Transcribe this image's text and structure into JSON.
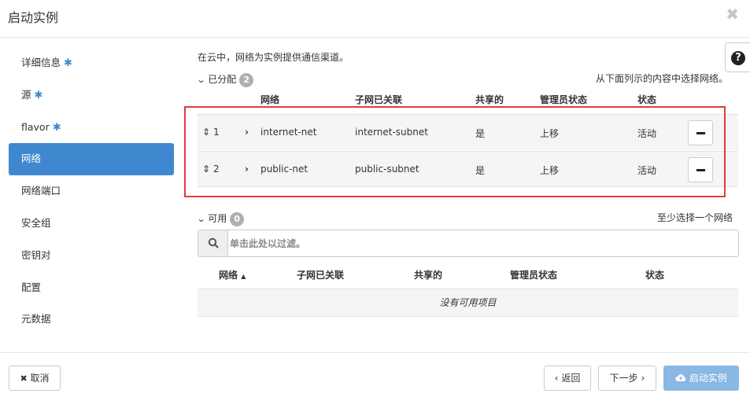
{
  "modal": {
    "title": "启动实例",
    "close": "✖"
  },
  "sidebar": {
    "items": [
      {
        "label": "详细信息",
        "required": true
      },
      {
        "label": "源",
        "required": true
      },
      {
        "label": "flavor",
        "required": true
      },
      {
        "label": "网络",
        "required": false,
        "active": true
      },
      {
        "label": "网络端口",
        "required": false
      },
      {
        "label": "安全组",
        "required": false
      },
      {
        "label": "密钥对",
        "required": false
      },
      {
        "label": "配置",
        "required": false
      },
      {
        "label": "元数据",
        "required": false
      }
    ],
    "required_mark": "✱"
  },
  "help": {
    "symbol": "?"
  },
  "description": "在云中，网络为实例提供通信渠道。",
  "allocated": {
    "title": "已分配",
    "count": "2",
    "hint": "从下面列示的内容中选择网络。",
    "columns": [
      "网络",
      "子网已关联",
      "共享的",
      "管理员状态",
      "状态"
    ],
    "rows": [
      {
        "order": "1",
        "name": "internet-net",
        "subnet": "internet-subnet",
        "shared": "是",
        "admin_state": "上移",
        "status": "活动"
      },
      {
        "order": "2",
        "name": "public-net",
        "subnet": "public-subnet",
        "shared": "是",
        "admin_state": "上移",
        "status": "活动"
      }
    ]
  },
  "available": {
    "title": "可用",
    "count": "0",
    "hint": "至少选择一个网络",
    "search_placeholder": "单击此处以过滤。",
    "columns": [
      "网络",
      "子网已关联",
      "共享的",
      "管理员状态",
      "状态"
    ],
    "sort_indicator": "▲",
    "empty_text": "没有可用项目"
  },
  "footer": {
    "cancel": "取消",
    "back": "返回",
    "next": "下一步",
    "launch": "启动实例"
  },
  "colors": {
    "accent": "#3f88d0",
    "highlight": "#e03c3c",
    "primary_disabled": "#8ab7e3"
  }
}
